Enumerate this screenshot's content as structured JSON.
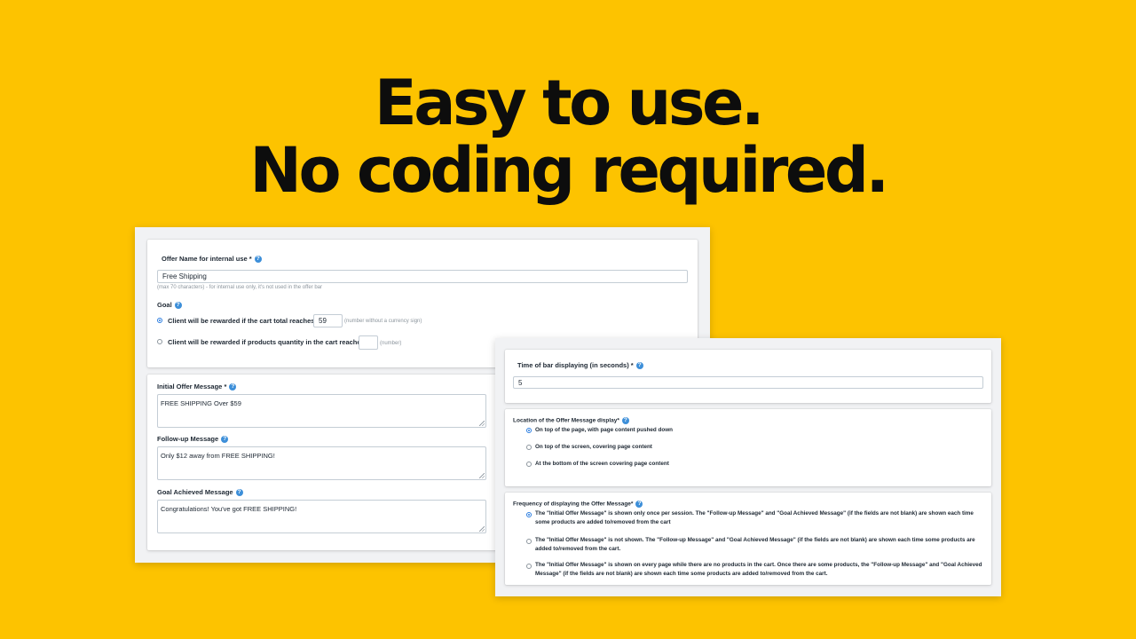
{
  "headline": {
    "line1": "Easy to use.",
    "line2": "No coding required."
  },
  "left_panel": {
    "offer_name": {
      "label": "Offer Name for internal use *",
      "value": "Free Shipping",
      "hint": "(max 70 characters) - for internal use only, it's not used in the offer bar"
    },
    "goal": {
      "label": "Goal",
      "options": [
        {
          "label": "Client will be rewarded if the cart total reaches:",
          "selected": true,
          "value": "59",
          "hint": "(number without a currency sign)"
        },
        {
          "label": "Client will be rewarded if products quantity in the cart reaches:",
          "selected": false,
          "value": "",
          "hint": "(number)"
        }
      ]
    },
    "messages": [
      {
        "label": "Initial Offer Message *",
        "value": "FREE SHIPPING Over $59"
      },
      {
        "label": "Follow-up Message",
        "value": "Only $12 away from FREE SHIPPING!"
      },
      {
        "label": "Goal Achieved Message",
        "value": "Congratulations! You've got FREE SHIPPING!"
      }
    ]
  },
  "right_panel": {
    "time": {
      "label": "Time of bar displaying (in seconds) *",
      "value": "5"
    },
    "location": {
      "label": "Location of the Offer Message display*",
      "options": [
        {
          "label": "On top of the page, with page content pushed down",
          "selected": true
        },
        {
          "label": "On top of the screen, covering page content",
          "selected": false
        },
        {
          "label": "At the bottom of the screen covering page content",
          "selected": false
        }
      ]
    },
    "frequency": {
      "label": "Frequency of displaying the Offer Message*",
      "options": [
        {
          "label": "The \"Initial Offer Message\" is shown only once per session. The \"Follow-up Message\" and \"Goal Achieved Message\" (if the fields are not blank) are shown each time some products are added to/removed from the cart",
          "selected": true
        },
        {
          "label": "The \"Initial Offer Message\" is not shown. The \"Follow-up Message\" and \"Goal Achieved Message\" (if the fields are not blank) are shown each time some products are added to/removed from the cart.",
          "selected": false
        },
        {
          "label": "The \"Initial Offer Message\" is shown on every page while there are no products in the cart. Once there are some products, the \"Follow-up Message\" and \"Goal Achieved Message\" (if the fields are not blank) are shown each time some products are added to/removed from the cart.",
          "selected": false
        }
      ]
    }
  },
  "icons": {
    "help": "question-mark-icon"
  },
  "colors": {
    "background": "#FDC300",
    "accent": "#2b7de0",
    "help_icon": "#3d8fd9"
  }
}
